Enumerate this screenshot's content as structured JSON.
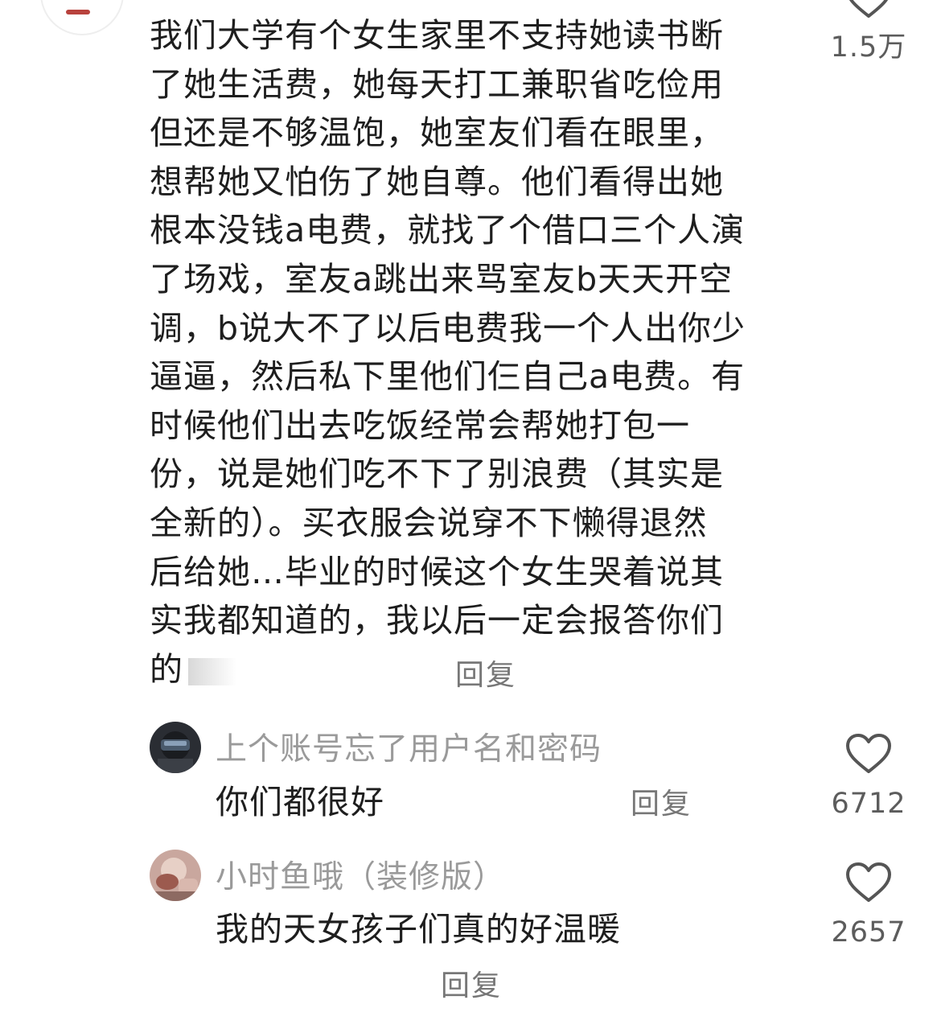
{
  "top_comment": {
    "lines": [
      "我们大学有个女生家里不支持她读书断",
      "了她生活费，她每天打工兼职省吃俭用",
      "但还是不够温饱，她室友们看在眼里，",
      "想帮她又怕伤了她自尊。他们看得出她",
      "根本没钱a电费，就找了个借口三个人演",
      "了场戏，室友a跳出来骂室友b天天开空",
      "调，b说大不了以后电费我一个人出你少",
      "逼逼，然后私下里他们仨自己a电费。有",
      "时候他们出去吃饭经常会帮她打包一",
      "份，说是她们吃不下了别浪费（其实是",
      "全新的）。买衣服会说穿不下懒得退然",
      "后给她…毕业的时候这个女生哭着说其",
      "实我都知道的，我以后一定会报答你们",
      "的"
    ],
    "reply_label": "回复",
    "like_count": "1.5万"
  },
  "sub_comments": [
    {
      "username": "上个账号忘了用户名和密码",
      "text": "你们都很好",
      "reply_label": "回复",
      "like_count": "6712"
    },
    {
      "username": "小时鱼哦（装修版）",
      "text": "我的天女孩子们真的好温暖",
      "reply_label": "回复",
      "like_count": "2657"
    }
  ],
  "colors": {
    "text": "#1e1e1e",
    "username": "#9a9a9a",
    "meta": "#777777",
    "heart_stroke": "#555555"
  },
  "icons": {
    "like": "heart-outline-icon"
  }
}
